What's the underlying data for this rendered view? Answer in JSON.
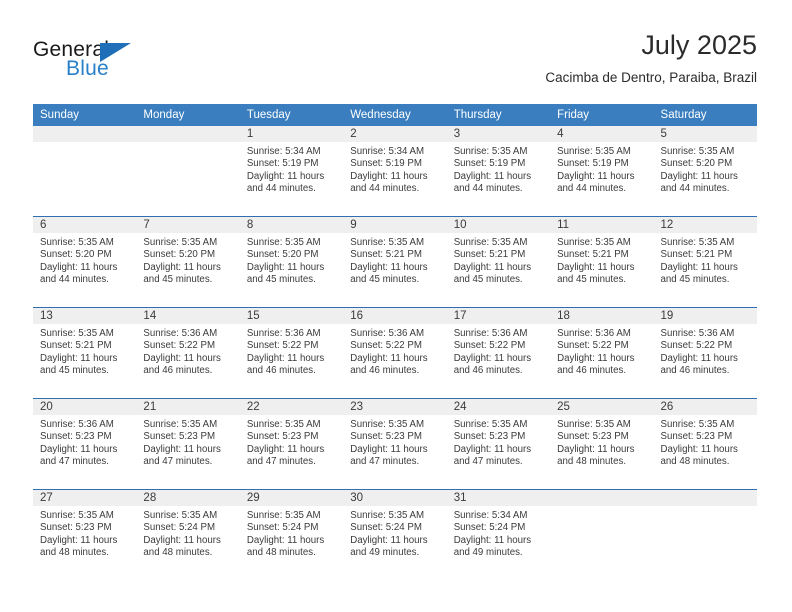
{
  "brand": {
    "name_top": "General",
    "name_bottom": "Blue",
    "triangle_icon": "triangle-icon",
    "color_dark": "#1a1a1a",
    "color_blue": "#2a7fc9"
  },
  "header": {
    "month_title": "July 2025",
    "location": "Cacimba de Dentro, Paraiba, Brazil"
  },
  "theme": {
    "header_bg": "#3a7ebf",
    "header_text": "#ffffff",
    "row_divider": "#2f6fb0",
    "daynum_band_bg": "#efefef",
    "body_text": "#3b3b3b"
  },
  "calendar": {
    "weekday_headers": [
      "Sunday",
      "Monday",
      "Tuesday",
      "Wednesday",
      "Thursday",
      "Friday",
      "Saturday"
    ],
    "weeks": [
      [
        {
          "day": "",
          "empty": true
        },
        {
          "day": "",
          "empty": true
        },
        {
          "day": "1",
          "sunrise": "Sunrise: 5:34 AM",
          "sunset": "Sunset: 5:19 PM",
          "daylight": "Daylight: 11 hours and 44 minutes."
        },
        {
          "day": "2",
          "sunrise": "Sunrise: 5:34 AM",
          "sunset": "Sunset: 5:19 PM",
          "daylight": "Daylight: 11 hours and 44 minutes."
        },
        {
          "day": "3",
          "sunrise": "Sunrise: 5:35 AM",
          "sunset": "Sunset: 5:19 PM",
          "daylight": "Daylight: 11 hours and 44 minutes."
        },
        {
          "day": "4",
          "sunrise": "Sunrise: 5:35 AM",
          "sunset": "Sunset: 5:19 PM",
          "daylight": "Daylight: 11 hours and 44 minutes."
        },
        {
          "day": "5",
          "sunrise": "Sunrise: 5:35 AM",
          "sunset": "Sunset: 5:20 PM",
          "daylight": "Daylight: 11 hours and 44 minutes."
        }
      ],
      [
        {
          "day": "6",
          "sunrise": "Sunrise: 5:35 AM",
          "sunset": "Sunset: 5:20 PM",
          "daylight": "Daylight: 11 hours and 44 minutes."
        },
        {
          "day": "7",
          "sunrise": "Sunrise: 5:35 AM",
          "sunset": "Sunset: 5:20 PM",
          "daylight": "Daylight: 11 hours and 45 minutes."
        },
        {
          "day": "8",
          "sunrise": "Sunrise: 5:35 AM",
          "sunset": "Sunset: 5:20 PM",
          "daylight": "Daylight: 11 hours and 45 minutes."
        },
        {
          "day": "9",
          "sunrise": "Sunrise: 5:35 AM",
          "sunset": "Sunset: 5:21 PM",
          "daylight": "Daylight: 11 hours and 45 minutes."
        },
        {
          "day": "10",
          "sunrise": "Sunrise: 5:35 AM",
          "sunset": "Sunset: 5:21 PM",
          "daylight": "Daylight: 11 hours and 45 minutes."
        },
        {
          "day": "11",
          "sunrise": "Sunrise: 5:35 AM",
          "sunset": "Sunset: 5:21 PM",
          "daylight": "Daylight: 11 hours and 45 minutes."
        },
        {
          "day": "12",
          "sunrise": "Sunrise: 5:35 AM",
          "sunset": "Sunset: 5:21 PM",
          "daylight": "Daylight: 11 hours and 45 minutes."
        }
      ],
      [
        {
          "day": "13",
          "sunrise": "Sunrise: 5:35 AM",
          "sunset": "Sunset: 5:21 PM",
          "daylight": "Daylight: 11 hours and 45 minutes."
        },
        {
          "day": "14",
          "sunrise": "Sunrise: 5:36 AM",
          "sunset": "Sunset: 5:22 PM",
          "daylight": "Daylight: 11 hours and 46 minutes."
        },
        {
          "day": "15",
          "sunrise": "Sunrise: 5:36 AM",
          "sunset": "Sunset: 5:22 PM",
          "daylight": "Daylight: 11 hours and 46 minutes."
        },
        {
          "day": "16",
          "sunrise": "Sunrise: 5:36 AM",
          "sunset": "Sunset: 5:22 PM",
          "daylight": "Daylight: 11 hours and 46 minutes."
        },
        {
          "day": "17",
          "sunrise": "Sunrise: 5:36 AM",
          "sunset": "Sunset: 5:22 PM",
          "daylight": "Daylight: 11 hours and 46 minutes."
        },
        {
          "day": "18",
          "sunrise": "Sunrise: 5:36 AM",
          "sunset": "Sunset: 5:22 PM",
          "daylight": "Daylight: 11 hours and 46 minutes."
        },
        {
          "day": "19",
          "sunrise": "Sunrise: 5:36 AM",
          "sunset": "Sunset: 5:22 PM",
          "daylight": "Daylight: 11 hours and 46 minutes."
        }
      ],
      [
        {
          "day": "20",
          "sunrise": "Sunrise: 5:36 AM",
          "sunset": "Sunset: 5:23 PM",
          "daylight": "Daylight: 11 hours and 47 minutes."
        },
        {
          "day": "21",
          "sunrise": "Sunrise: 5:35 AM",
          "sunset": "Sunset: 5:23 PM",
          "daylight": "Daylight: 11 hours and 47 minutes."
        },
        {
          "day": "22",
          "sunrise": "Sunrise: 5:35 AM",
          "sunset": "Sunset: 5:23 PM",
          "daylight": "Daylight: 11 hours and 47 minutes."
        },
        {
          "day": "23",
          "sunrise": "Sunrise: 5:35 AM",
          "sunset": "Sunset: 5:23 PM",
          "daylight": "Daylight: 11 hours and 47 minutes."
        },
        {
          "day": "24",
          "sunrise": "Sunrise: 5:35 AM",
          "sunset": "Sunset: 5:23 PM",
          "daylight": "Daylight: 11 hours and 47 minutes."
        },
        {
          "day": "25",
          "sunrise": "Sunrise: 5:35 AM",
          "sunset": "Sunset: 5:23 PM",
          "daylight": "Daylight: 11 hours and 48 minutes."
        },
        {
          "day": "26",
          "sunrise": "Sunrise: 5:35 AM",
          "sunset": "Sunset: 5:23 PM",
          "daylight": "Daylight: 11 hours and 48 minutes."
        }
      ],
      [
        {
          "day": "27",
          "sunrise": "Sunrise: 5:35 AM",
          "sunset": "Sunset: 5:23 PM",
          "daylight": "Daylight: 11 hours and 48 minutes."
        },
        {
          "day": "28",
          "sunrise": "Sunrise: 5:35 AM",
          "sunset": "Sunset: 5:24 PM",
          "daylight": "Daylight: 11 hours and 48 minutes."
        },
        {
          "day": "29",
          "sunrise": "Sunrise: 5:35 AM",
          "sunset": "Sunset: 5:24 PM",
          "daylight": "Daylight: 11 hours and 48 minutes."
        },
        {
          "day": "30",
          "sunrise": "Sunrise: 5:35 AM",
          "sunset": "Sunset: 5:24 PM",
          "daylight": "Daylight: 11 hours and 49 minutes."
        },
        {
          "day": "31",
          "sunrise": "Sunrise: 5:34 AM",
          "sunset": "Sunset: 5:24 PM",
          "daylight": "Daylight: 11 hours and 49 minutes."
        },
        {
          "day": "",
          "empty": true
        },
        {
          "day": "",
          "empty": true
        }
      ]
    ]
  }
}
